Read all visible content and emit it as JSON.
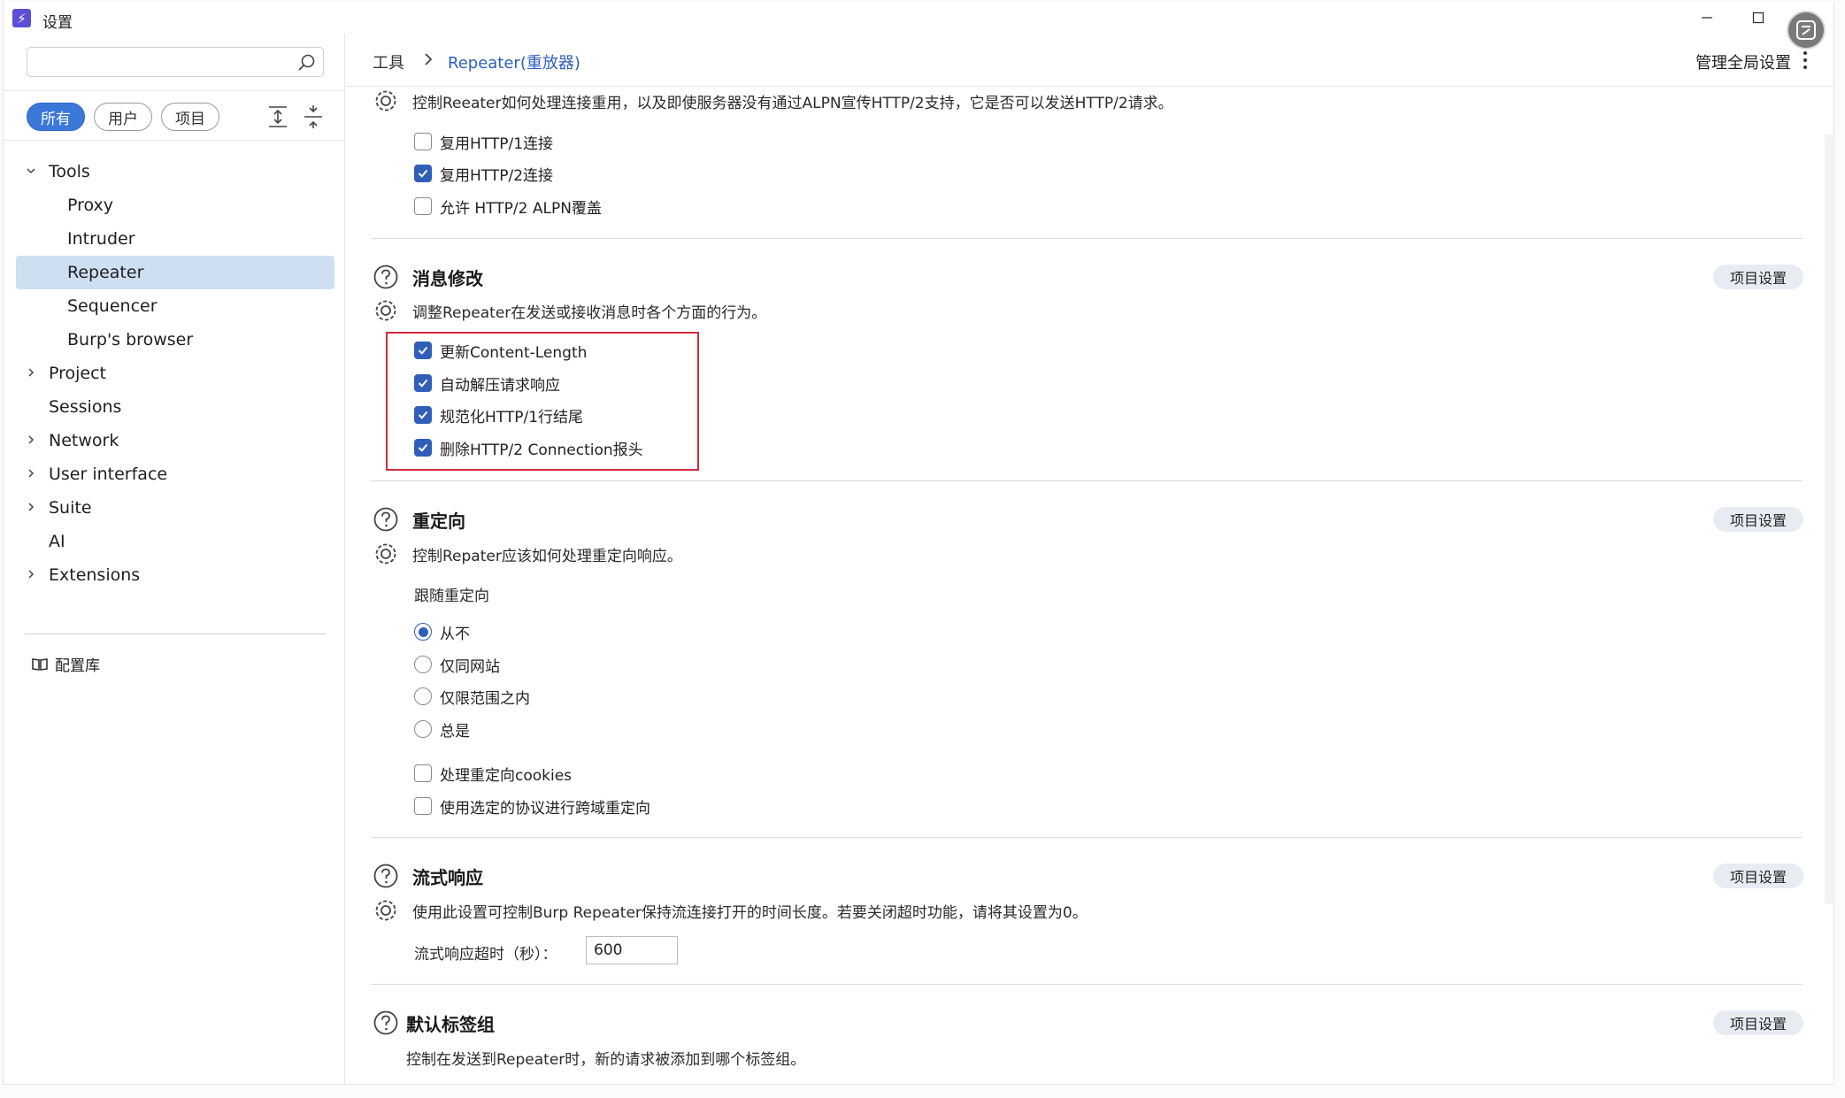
{
  "window": {
    "title": "设置"
  },
  "sidebar": {
    "search": {
      "value": "",
      "placeholder": ""
    },
    "filters": [
      {
        "label": "所有",
        "active": true
      },
      {
        "label": "用户",
        "active": false
      },
      {
        "label": "项目",
        "active": false
      }
    ],
    "tree": [
      {
        "label": "Tools",
        "expanded": true
      },
      {
        "label": "Proxy"
      },
      {
        "label": "Intruder"
      },
      {
        "label": "Repeater",
        "selected": true
      },
      {
        "label": "Sequencer"
      },
      {
        "label": "Burp's browser"
      },
      {
        "label": "Project",
        "expanded": false
      },
      {
        "label": "Sessions"
      },
      {
        "label": "Network",
        "expanded": false
      },
      {
        "label": "User interface",
        "expanded": false
      },
      {
        "label": "Suite",
        "expanded": false
      },
      {
        "label": "AI"
      },
      {
        "label": "Extensions",
        "expanded": false
      }
    ],
    "config_library": "配置库"
  },
  "header": {
    "breadcrumb_root": "工具",
    "breadcrumb_current": "Repeater(重放器)",
    "manage_global": "管理全局设置"
  },
  "connections": {
    "description": "控制Reeater如何处理连接重用，以及即使服务器没有通过ALPN宣传HTTP/2支持，它是否可以发送HTTP/2请求。",
    "options": [
      {
        "label": "复用HTTP/1连接",
        "checked": false
      },
      {
        "label": "复用HTTP/2连接",
        "checked": true
      },
      {
        "label": "允许 HTTP/2 ALPN覆盖",
        "checked": false
      }
    ]
  },
  "message_modification": {
    "title": "消息修改",
    "project_button": "项目设置",
    "description": "调整Repeater在发送或接收消息时各个方面的行为。",
    "options": [
      {
        "label": "更新Content-Length",
        "checked": true
      },
      {
        "label": "自动解压请求响应",
        "checked": true
      },
      {
        "label": "规范化HTTP/1行结尾",
        "checked": true
      },
      {
        "label": "删除HTTP/2 Connection报头",
        "checked": true
      }
    ]
  },
  "redirects": {
    "title": "重定向",
    "project_button": "项目设置",
    "description": "控制Repater应该如何处理重定向响应。",
    "follow_label": "跟随重定向",
    "radios": [
      {
        "label": "从不",
        "checked": true
      },
      {
        "label": "仅同网站",
        "checked": false
      },
      {
        "label": "仅限范围之内",
        "checked": false
      },
      {
        "label": "总是",
        "checked": false
      }
    ],
    "options": [
      {
        "label": "处理重定向cookies",
        "checked": false
      },
      {
        "label": "使用选定的协议进行跨域重定向",
        "checked": false
      }
    ]
  },
  "streaming": {
    "title": "流式响应",
    "project_button": "项目设置",
    "description": "使用此设置可控制Burp Repeater保持流连接打开的时间长度。若要关闭超时功能，请将其设置为0。",
    "timeout_label": "流式响应超时（秒）：",
    "timeout_value": "600"
  },
  "default_tab_group": {
    "title": "默认标签组",
    "project_button": "项目设置",
    "description": "控制在发送到Repeater时，新的请求被添加到哪个标签组。"
  },
  "colors": {
    "accent": "#2f5fb8",
    "highlight_border": "#d32a3a",
    "selected_bg": "#cfdff2",
    "pill_active": "#3b78d8"
  }
}
